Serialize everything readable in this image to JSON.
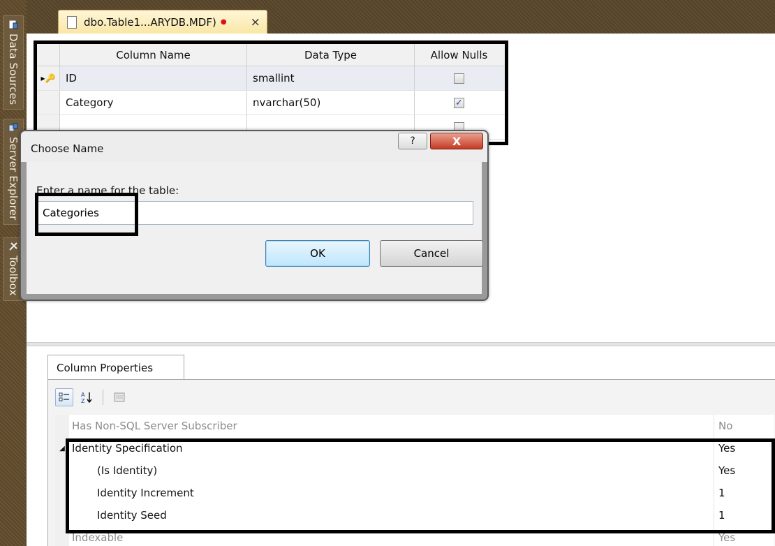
{
  "side_panels": [
    {
      "label": "Data Sources",
      "icon": "database-icon"
    },
    {
      "label": "Server Explorer",
      "icon": "server-icon"
    },
    {
      "label": "Toolbox",
      "icon": "toolbox-icon"
    }
  ],
  "document_tab": {
    "title": "dbo.Table1...ARYDB.MDF)",
    "dirty_marker": "●",
    "close_glyph": "×"
  },
  "table_designer": {
    "columns": [
      "Column Name",
      "Data Type",
      "Allow Nulls"
    ],
    "rows": [
      {
        "name": "ID",
        "type": "smallint",
        "allow_nulls": false,
        "primary_key": true
      },
      {
        "name": "Category",
        "type": "nvarchar(50)",
        "allow_nulls": true,
        "primary_key": false
      },
      {
        "name": "",
        "type": "",
        "allow_nulls": false,
        "primary_key": false
      }
    ]
  },
  "dialog": {
    "title": "Choose Name",
    "help_glyph": "?",
    "close_glyph": "X",
    "prompt": "Enter a name for the table:",
    "name_value": "Categories",
    "ok_label": "OK",
    "cancel_label": "Cancel"
  },
  "column_properties": {
    "tab_label": "Column Properties",
    "rows": [
      {
        "name": "Has Non-SQL Server Subscriber",
        "value": "No",
        "dim": true,
        "indent": false,
        "expander": ""
      },
      {
        "name": "Identity Specification",
        "value": "Yes",
        "dim": false,
        "indent": false,
        "expander": "◢"
      },
      {
        "name": "(Is Identity)",
        "value": "Yes",
        "dim": false,
        "indent": true,
        "expander": ""
      },
      {
        "name": "Identity Increment",
        "value": "1",
        "dim": false,
        "indent": true,
        "expander": ""
      },
      {
        "name": "Identity Seed",
        "value": "1",
        "dim": false,
        "indent": true,
        "expander": ""
      },
      {
        "name": "Indexable",
        "value": "Yes",
        "dim": true,
        "indent": false,
        "expander": ""
      }
    ]
  },
  "colors": {
    "ok_border": "#3c7fb1",
    "close_red": "#c63b23",
    "checkbox_tick": "#22429c"
  }
}
